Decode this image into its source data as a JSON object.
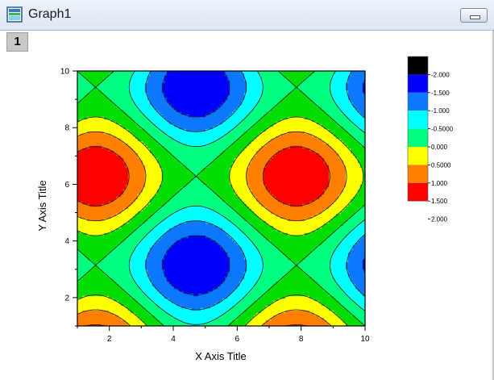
{
  "window": {
    "title": "Graph1",
    "layer_tab": "1",
    "icon": "graph-window-icon",
    "minimize_icon": "minimize-icon"
  },
  "chart_data": {
    "type": "contour",
    "title": "",
    "xlabel": "X Axis Title",
    "ylabel": "Y Axis Title",
    "xlim": [
      1,
      10
    ],
    "ylim": [
      1,
      10
    ],
    "x_ticks": [
      "2",
      "4",
      "6",
      "8",
      "10"
    ],
    "y_ticks": [
      "2",
      "4",
      "6",
      "8",
      "10"
    ],
    "function": "z = sin(x) + cos(y)",
    "levels": [
      -2.0,
      -1.5,
      -1.0,
      -0.5,
      0.0,
      0.5,
      1.0,
      1.5,
      2.0
    ],
    "level_colors": [
      "#000000",
      "#0000ff",
      "#0a78ff",
      "#00ffff",
      "#00ff7f",
      "#00dd00",
      "#ffff00",
      "#ff7f00",
      "#ff0000"
    ],
    "colorbar_labels": [
      "-2.000",
      "-1.500",
      "-1.000",
      "-0.5000",
      "0.000",
      "0.5000",
      "1.000",
      "1.500",
      "2.000"
    ],
    "colorbar_colors": [
      "#000000",
      "#0000ff",
      "#0a78ff",
      "#00ffff",
      "#00ff7f",
      "#ffff00",
      "#ff7f00",
      "#ff0000"
    ],
    "legend_position": "right"
  }
}
